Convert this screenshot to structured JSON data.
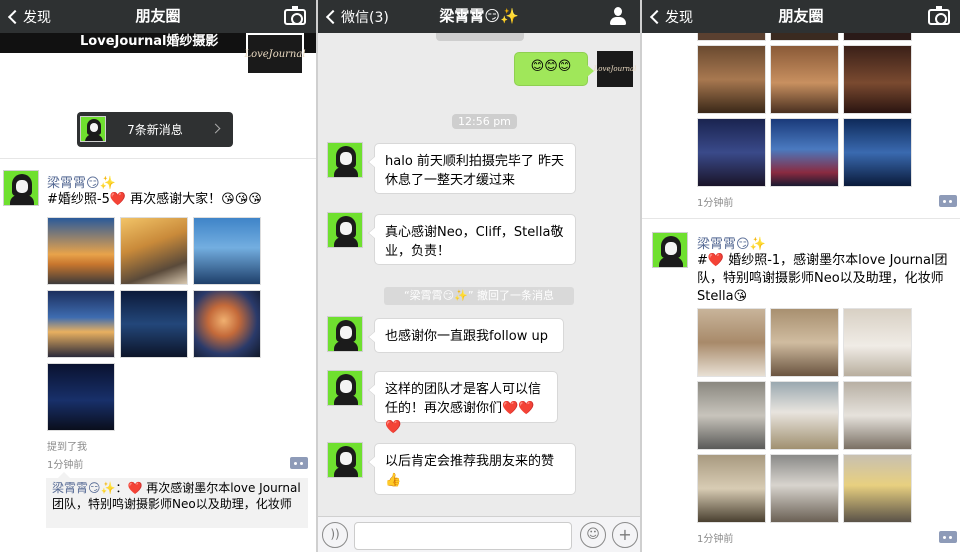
{
  "moments_left": {
    "nav": {
      "back_label": "发现",
      "title": "朋友圈"
    },
    "cover_text": "LoveJournal婚纱摄影",
    "cover_logo": "LoveJournal",
    "new_messages_label": "7条新消息",
    "post": {
      "username": "梁霄霄😏✨",
      "text": "#婚纱照-5❤️ 再次感谢大家！😘😘😘",
      "mention": "提到了我",
      "time": "1分钟前",
      "comment_author": "梁霄霄😏✨",
      "comment_text": "：❤️ 再次感谢墨尔本love Journal团队，特别鸣谢摄影师Neo以及助理，化妆师"
    }
  },
  "chat": {
    "nav": {
      "back_label": "微信(3)",
      "title": "梁霄霄😏✨"
    },
    "my_message": "😊😊😊",
    "my_logo": "LoveJournal",
    "timestamp": "12:56 pm",
    "messages": [
      "halo 前天顺利拍摄完毕了 昨天休息了一整天才缓过来",
      "真心感谢Neo，Cliff，Stella敬业，负责！",
      "也感谢你一直跟我follow up",
      "这样的团队才是客人可以信任的！再次感谢你们❤️❤️❤️",
      "以后肯定会推荐我朋友来的赞👍"
    ],
    "recall_notice": "“梁霄霄😏✨” 撤回了一条消息"
  },
  "moments_right": {
    "nav": {
      "back_label": "发现",
      "title": "朋友圈"
    },
    "top_time": "1分钟前",
    "post": {
      "username": "梁霄霄😏✨",
      "text": "#❤️ 婚纱照-1，感谢墨尔本love Journal团队，特别鸣谢摄影师Neo以及助理，化妆师Stella😘",
      "time": "1分钟前"
    }
  },
  "colors": {
    "nav_bar": "#2e3132",
    "wechat_link_blue": "#576b95",
    "my_bubble_green": "#a0e75a",
    "avatar_green": "#6fe02f"
  },
  "icons": [
    "chevron-left-icon",
    "camera-icon",
    "person-icon",
    "comment-icon",
    "voice-icon",
    "emoji-icon",
    "plus-icon"
  ]
}
